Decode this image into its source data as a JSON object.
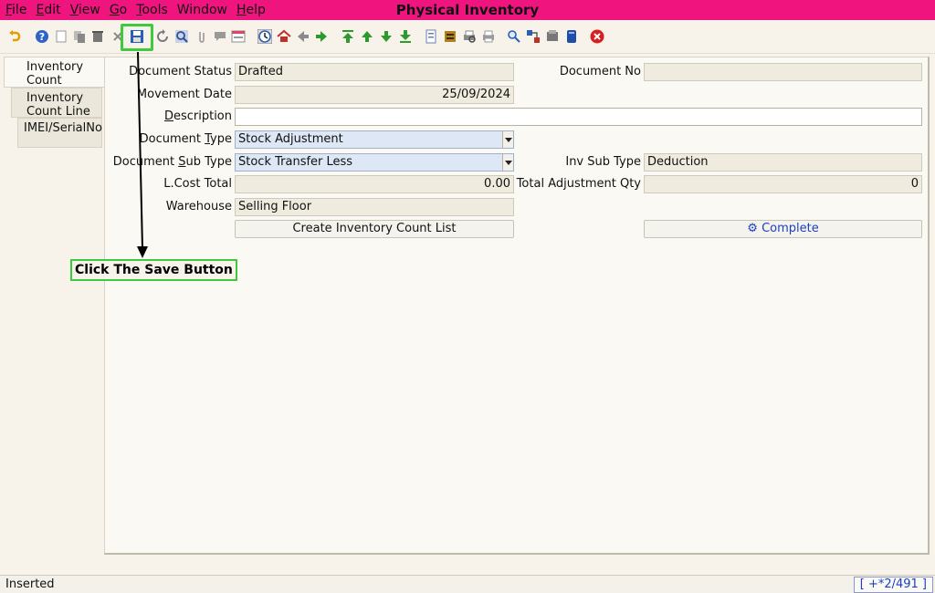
{
  "window": {
    "title": "Physical Inventory"
  },
  "menu": [
    {
      "pre": "",
      "u": "F",
      "post": "ile"
    },
    {
      "pre": "",
      "u": "E",
      "post": "dit"
    },
    {
      "pre": "",
      "u": "V",
      "post": "iew"
    },
    {
      "pre": "",
      "u": "G",
      "post": "o"
    },
    {
      "pre": "",
      "u": "T",
      "post": "ools"
    },
    {
      "pre": "",
      "u": "",
      "post": "Window"
    },
    {
      "pre": "",
      "u": "H",
      "post": "elp"
    }
  ],
  "toolbar": {
    "icons": [
      "undo-icon",
      "help-icon",
      "new-record-icon",
      "copy-record-icon",
      "delete-icon",
      "delete-selection-icon",
      "save-icon",
      "refresh-icon",
      "find-icon",
      "attachment-icon",
      "chat-icon",
      "multi-view-icon",
      "history-icon",
      "home-icon",
      "back-icon",
      "forward-icon",
      "first-record-icon",
      "previous-record-icon",
      "next-record-icon",
      "last-record-icon",
      "report-icon",
      "archive-icon",
      "print-preview-icon",
      "print-icon",
      "zoom-across-icon",
      "workflow-icon",
      "request-icon",
      "product-info-icon",
      "close-window-icon"
    ]
  },
  "tabs": [
    {
      "label_1": "Inventory",
      "label_2": "Count"
    },
    {
      "label_1": "Inventory",
      "label_2": "Count Line"
    },
    {
      "label_1": "IMEI/SerialNo",
      "label_2": ""
    }
  ],
  "form": {
    "document_status": {
      "label": "Document Status",
      "value": "Drafted"
    },
    "document_no": {
      "label": "Document No",
      "value": ""
    },
    "movement_date": {
      "label": "Movement Date",
      "value": "25/09/2024"
    },
    "description": {
      "label_pre": "",
      "label_u": "D",
      "label_post": "escription",
      "value": ""
    },
    "document_type": {
      "label_pre": "Document ",
      "label_u": "T",
      "label_post": "ype",
      "value": "Stock Adjustment"
    },
    "document_sub_type": {
      "label_pre": "Document ",
      "label_u": "S",
      "label_post": "ub Type",
      "value": "Stock Transfer Less"
    },
    "inv_sub_type": {
      "label": "Inv Sub Type",
      "value": "Deduction"
    },
    "lcost_total": {
      "label": "L.Cost Total",
      "value": "0.00"
    },
    "total_adjustment_qty": {
      "label": "Total Adjustment Qty",
      "value": "0"
    },
    "warehouse": {
      "label": "Warehouse",
      "value": "Selling Floor"
    },
    "create_list_button": "Create Inventory Count List",
    "complete_button": "Complete"
  },
  "annotation": {
    "text": "Click The Save Button",
    "color": "#3ec93e"
  },
  "status": {
    "message": "Inserted",
    "record_info": "[ +*2/491 ]"
  },
  "colors": {
    "menubar": "#f0157e",
    "accent": "#1a3fc4",
    "highlight": "#3ec93e"
  }
}
